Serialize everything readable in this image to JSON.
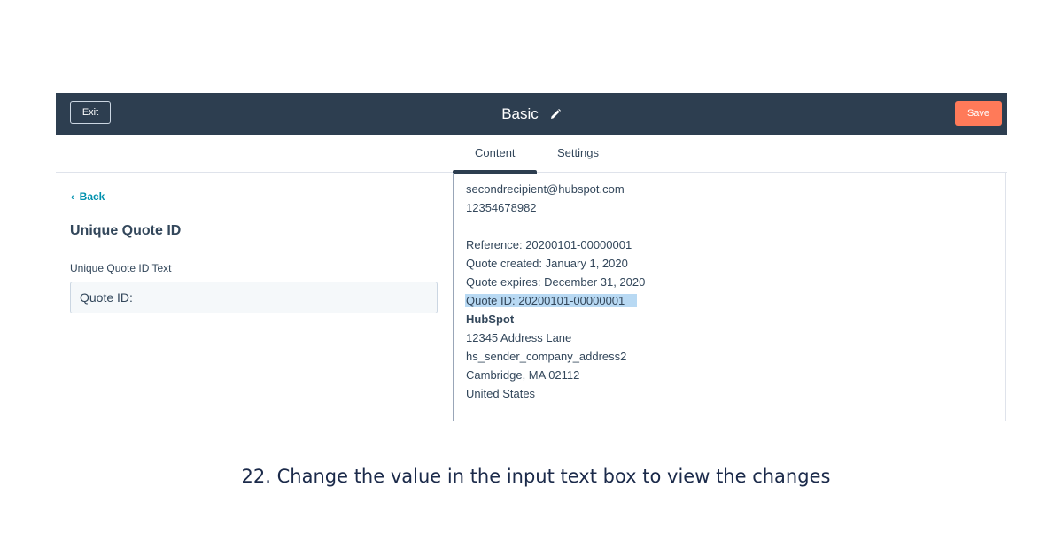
{
  "header": {
    "exit_label": "Exit",
    "title": "Basic",
    "edit_icon": "pencil-icon",
    "save_label": "Save",
    "save_color": "#ff7a59",
    "bar_color": "#2d3e50"
  },
  "tabs": [
    {
      "label": "Content",
      "active": true
    },
    {
      "label": "Settings",
      "active": false
    }
  ],
  "left_panel": {
    "back_label": "Back",
    "back_icon": "chevron-left-icon",
    "section_title": "Unique Quote ID",
    "field_label": "Unique Quote ID Text",
    "field_value": "Quote ID:"
  },
  "preview": {
    "lines": [
      "secondrecipient@hubspot.com",
      "12354678982",
      "",
      "Reference: 20200101-00000001",
      "Quote created: January 1, 2020",
      "Quote expires: December 31, 2020",
      "Quote ID: 20200101-00000001",
      "HubSpot",
      "12345 Address Lane",
      "hs_sender_company_address2",
      "Cambridge, MA 02112",
      "United States"
    ],
    "highlight_color": "#b8d9f3"
  },
  "caption": "22. Change the value in the input text box to view the changes"
}
